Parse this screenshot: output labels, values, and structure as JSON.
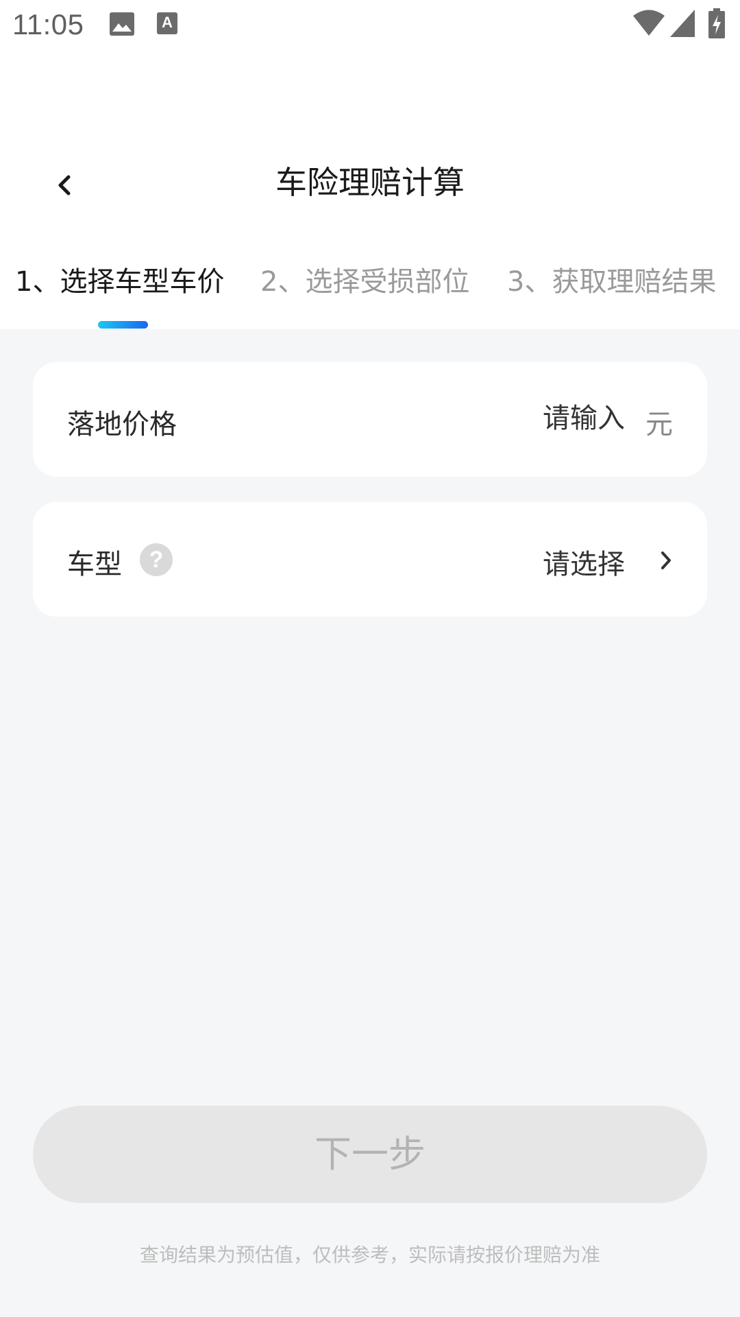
{
  "status_bar": {
    "time": "11:05",
    "icons": [
      "image-icon",
      "a-text-icon",
      "wifi-icon",
      "signal-icon",
      "battery-charging-icon"
    ]
  },
  "header": {
    "title": "车险理赔计算",
    "back_icon": "chevron-left-icon"
  },
  "steps": [
    {
      "label": "1、选择车型车价",
      "active": true
    },
    {
      "label": "2、选择受损部位",
      "active": false
    },
    {
      "label": "3、获取理赔结果",
      "active": false
    }
  ],
  "form": {
    "price": {
      "label": "落地价格",
      "placeholder": "请输入",
      "value": "",
      "unit": "元"
    },
    "model": {
      "label": "车型",
      "help_icon": "question-icon",
      "value": "请选择"
    }
  },
  "next_button": {
    "label": "下一步",
    "enabled": false
  },
  "disclaimer": "查询结果为预估值，仅供参考，实际请按报价理赔为准",
  "colors": {
    "accent_start": "#1ec8f0",
    "accent_end": "#1a66f0",
    "background": "#f5f6f8",
    "disabled_button": "#e6e6e6"
  }
}
